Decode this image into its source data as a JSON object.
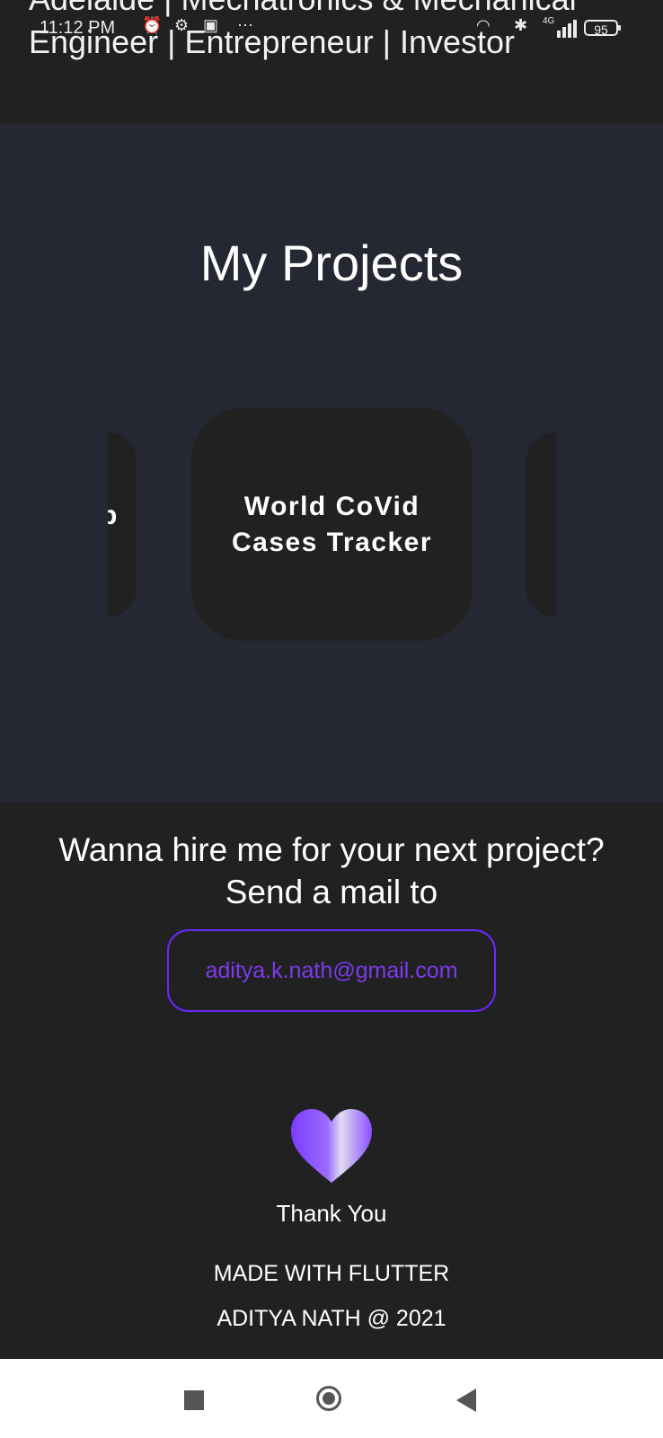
{
  "status_bar": {
    "time": "11:12 PM",
    "battery": "95",
    "network": "4G",
    "icons": [
      "alarm-icon",
      "settings-icon",
      "cast-icon",
      "more-icon",
      "wifi-icon",
      "bluetooth-icon",
      "signal-icon",
      "battery-icon"
    ]
  },
  "header": {
    "line1": "Adelaide | Mechatronics & Mechanical",
    "line2": "Engineer | Entrepreneur | Investor"
  },
  "projects": {
    "title": "My Projects",
    "cards": [
      {
        "label": "p"
      },
      {
        "label": "World CoVid Cases Tracker"
      },
      {
        "label": ""
      }
    ]
  },
  "contact": {
    "line1": "Wanna hire me for your next project?",
    "line2": "Send a mail to",
    "email": "aditya.k.nath@gmail.com"
  },
  "footer": {
    "heart_icon": "heart-icon",
    "thanks": "Thank You",
    "made_with": "MADE WITH FLUTTER",
    "copyright": "ADITYA NATH @ 2021"
  },
  "nav": {
    "recents": "recents-icon",
    "home": "home-icon",
    "back": "back-icon"
  },
  "colors": {
    "background": "#212121",
    "projects_bg": "#252733",
    "accent": "#6a28ff",
    "email_text": "#7c3aed"
  }
}
